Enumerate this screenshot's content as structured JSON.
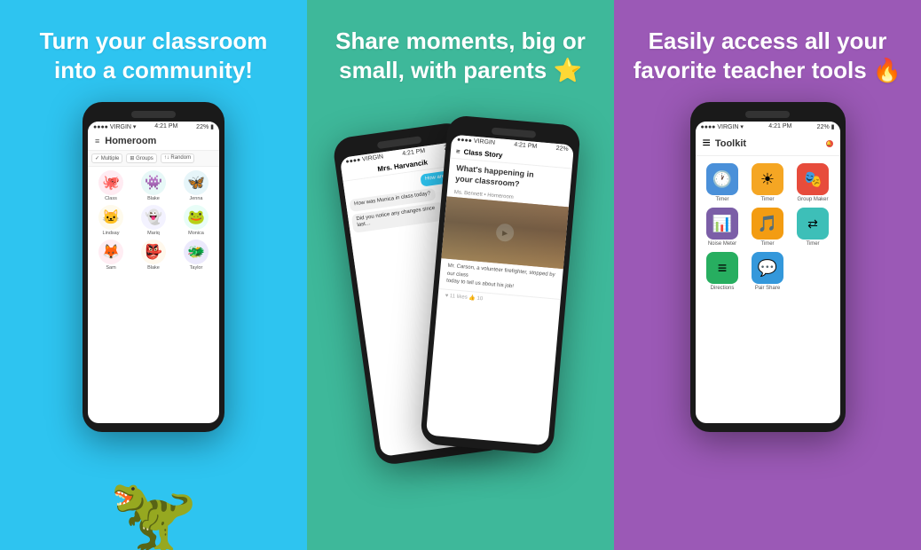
{
  "panel1": {
    "title": "Turn your classroom\ninto a community!",
    "screen": {
      "status": "4:21 PM",
      "carrier": "●●●● VIRGIN",
      "battery": "22%",
      "app_title": "Homeroom",
      "filters": [
        "✓ Multiple",
        "⊞ Groups",
        "↑↓ Random"
      ],
      "students": [
        {
          "name": "Class",
          "emoji": "🐙",
          "color": "#FF6B9D"
        },
        {
          "name": "Blake",
          "emoji": "👾",
          "color": "#4ECDC4"
        },
        {
          "name": "Jenna",
          "emoji": "🦋",
          "color": "#45B7D1"
        },
        {
          "name": "Lindsay",
          "emoji": "🐱",
          "color": "#F7DC6F"
        },
        {
          "name": "Mariq",
          "emoji": "👻",
          "color": "#A29BFE"
        },
        {
          "name": "Monica",
          "emoji": "🐸",
          "color": "#55EFC4"
        },
        {
          "name": "Sam",
          "emoji": "🦊",
          "color": "#FD79A8"
        },
        {
          "name": "Blake",
          "emoji": "👺",
          "color": "#FDCB6E"
        },
        {
          "name": "Taylor",
          "emoji": "🐲",
          "color": "#6C5CE7"
        }
      ]
    }
  },
  "panel2": {
    "title": "Share moments, big or\nsmall, with parents ⭐",
    "screen_back": {
      "header": "Mrs. Harvancik",
      "messages": [
        {
          "text": "How are you?",
          "type": "sent"
        },
        {
          "text": "How was Monica in class today?",
          "type": "received"
        },
        {
          "text": "Did you notice any changes since last…",
          "type": "received"
        }
      ]
    },
    "screen_front": {
      "header": "Class Story",
      "question": "What's happening in\nyour classroom?",
      "author": "Ms. Bennett • Homeroom",
      "caption": "Mr. Carson, a volunteer firefighter, stopped by our class\ntoday to tell us about his job!"
    }
  },
  "panel3": {
    "title": "Easily access all your\nfavorite teacher tools 🔥",
    "screen": {
      "status": "4:21 PM",
      "carrier": "●●●● VIRGIN",
      "battery": "22%",
      "app_title": "Toolkit",
      "tools": [
        {
          "name": "Timer",
          "icon": "🕐",
          "color_class": "ti-blue"
        },
        {
          "name": "Timer",
          "icon": "☀",
          "color_class": "ti-yellow"
        },
        {
          "name": "Group Maker",
          "icon": "🎭",
          "color_class": "ti-red"
        },
        {
          "name": "Noise Meter",
          "icon": "📊",
          "color_class": "ti-purple"
        },
        {
          "name": "Timer",
          "icon": "🎵",
          "color_class": "ti-orange"
        },
        {
          "name": "Timer",
          "icon": "⇄",
          "color_class": "ti-teal"
        },
        {
          "name": "Directions",
          "icon": "≡",
          "color_class": "ti-green"
        },
        {
          "name": "Pair Share",
          "icon": "💬",
          "color_class": "ti-lightblue"
        }
      ]
    }
  }
}
